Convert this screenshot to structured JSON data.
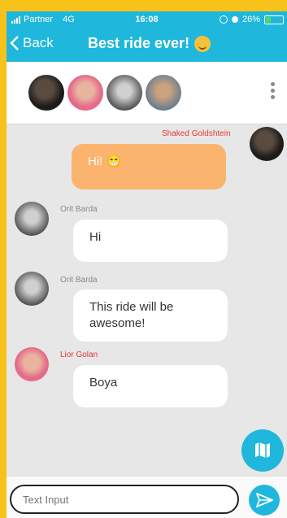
{
  "status_bar": {
    "carrier": "Partner",
    "network": "4G",
    "time": "16:08",
    "battery": "26%"
  },
  "header": {
    "back_label": "Back",
    "title": "Best ride ever!",
    "title_emoji": "grinning-tongue-emoji",
    "color": "#1fb7dc"
  },
  "members": [
    {
      "name": "member-1-avatar"
    },
    {
      "name": "member-2-avatar"
    },
    {
      "name": "member-3-avatar"
    },
    {
      "name": "member-4-avatar"
    }
  ],
  "messages": [
    {
      "sender": "Shaked Goldshtein",
      "text": "Hi! 😁",
      "own": true
    },
    {
      "sender": "Orit Barda",
      "text": "Hi",
      "own": false
    },
    {
      "sender": "Orit Barda",
      "text": "This ride will be awesome!",
      "own": false
    },
    {
      "sender": "Lior Golan",
      "text": "Boya",
      "own": false
    }
  ],
  "composer": {
    "placeholder": "Text Input",
    "value": ""
  },
  "colors": {
    "accent": "#1fb7dc",
    "own_bubble": "#fbb46d",
    "sender_highlight": "#e53935",
    "sender_muted": "#888888"
  }
}
